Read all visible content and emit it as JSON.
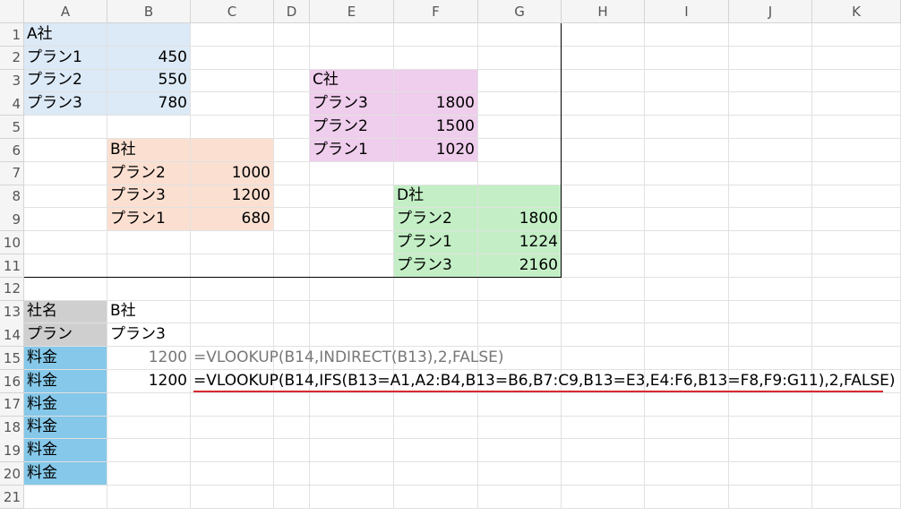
{
  "columns": [
    "A",
    "B",
    "C",
    "D",
    "E",
    "F",
    "G",
    "H",
    "I",
    "J",
    "K"
  ],
  "rows": [
    "1",
    "2",
    "3",
    "4",
    "5",
    "6",
    "7",
    "8",
    "9",
    "10",
    "11",
    "12",
    "13",
    "14",
    "15",
    "16",
    "17",
    "18",
    "19",
    "20",
    "21"
  ],
  "colors": {
    "a_block": "#dce9f6",
    "b_block": "#fbe0d2",
    "c_block": "#efcdec",
    "d_block": "#c4efc6",
    "label_gray": "#cfcfcf",
    "label_blue": "#85c8e9",
    "underline_red": "#d9282f"
  },
  "cells": [
    {
      "ref": "A1",
      "text": "A社",
      "fill": "a_block"
    },
    {
      "ref": "B1",
      "text": "",
      "fill": "a_block"
    },
    {
      "ref": "A2",
      "text": "プラン1",
      "fill": "a_block"
    },
    {
      "ref": "B2",
      "text": "450",
      "fill": "a_block",
      "align": "right"
    },
    {
      "ref": "A3",
      "text": "プラン2",
      "fill": "a_block"
    },
    {
      "ref": "B3",
      "text": "550",
      "fill": "a_block",
      "align": "right"
    },
    {
      "ref": "A4",
      "text": "プラン3",
      "fill": "a_block"
    },
    {
      "ref": "B4",
      "text": "780",
      "fill": "a_block",
      "align": "right"
    },
    {
      "ref": "E3",
      "text": "C社",
      "fill": "c_block"
    },
    {
      "ref": "F3",
      "text": "",
      "fill": "c_block"
    },
    {
      "ref": "E4",
      "text": "プラン3",
      "fill": "c_block"
    },
    {
      "ref": "F4",
      "text": "1800",
      "fill": "c_block",
      "align": "right"
    },
    {
      "ref": "E5",
      "text": "プラン2",
      "fill": "c_block"
    },
    {
      "ref": "F5",
      "text": "1500",
      "fill": "c_block",
      "align": "right"
    },
    {
      "ref": "E6",
      "text": "プラン1",
      "fill": "c_block"
    },
    {
      "ref": "F6",
      "text": "1020",
      "fill": "c_block",
      "align": "right"
    },
    {
      "ref": "B6",
      "text": "B社",
      "fill": "b_block"
    },
    {
      "ref": "C6",
      "text": "",
      "fill": "b_block"
    },
    {
      "ref": "B7",
      "text": "プラン2",
      "fill": "b_block"
    },
    {
      "ref": "C7",
      "text": "1000",
      "fill": "b_block",
      "align": "right"
    },
    {
      "ref": "B8",
      "text": "プラン3",
      "fill": "b_block"
    },
    {
      "ref": "C8",
      "text": "1200",
      "fill": "b_block",
      "align": "right"
    },
    {
      "ref": "B9",
      "text": "プラン1",
      "fill": "b_block"
    },
    {
      "ref": "C9",
      "text": "680",
      "fill": "b_block",
      "align": "right"
    },
    {
      "ref": "F8",
      "text": "D社",
      "fill": "d_block"
    },
    {
      "ref": "G8",
      "text": "",
      "fill": "d_block"
    },
    {
      "ref": "F9",
      "text": "プラン2",
      "fill": "d_block"
    },
    {
      "ref": "G9",
      "text": "1800",
      "fill": "d_block",
      "align": "right"
    },
    {
      "ref": "F10",
      "text": "プラン1",
      "fill": "d_block"
    },
    {
      "ref": "G10",
      "text": "1224",
      "fill": "d_block",
      "align": "right"
    },
    {
      "ref": "F11",
      "text": "プラン3",
      "fill": "d_block"
    },
    {
      "ref": "G11",
      "text": "2160",
      "fill": "d_block",
      "align": "right"
    },
    {
      "ref": "A13",
      "text": "社名",
      "fill": "label_gray"
    },
    {
      "ref": "B13",
      "text": "B社"
    },
    {
      "ref": "A14",
      "text": "プラン",
      "fill": "label_gray"
    },
    {
      "ref": "B14",
      "text": "プラン3"
    },
    {
      "ref": "A15",
      "text": "料金",
      "fill": "label_blue"
    },
    {
      "ref": "B15",
      "text": "1200",
      "align": "right",
      "style": "gray"
    },
    {
      "ref": "C15",
      "text": "=VLOOKUP(B14,INDIRECT(B13),2,FALSE)",
      "style": "gray"
    },
    {
      "ref": "A16",
      "text": "料金",
      "fill": "label_blue"
    },
    {
      "ref": "B16",
      "text": "1200",
      "align": "right"
    },
    {
      "ref": "C16",
      "text": "=VLOOKUP(B14,IFS(B13=A1,A2:B4,B13=B6,B7:C9,B13=E3,E4:F6,B13=F8,F9:G11),2,FALSE)"
    },
    {
      "ref": "A17",
      "text": "料金",
      "fill": "label_blue"
    },
    {
      "ref": "A18",
      "text": "料金",
      "fill": "label_blue"
    },
    {
      "ref": "A19",
      "text": "料金",
      "fill": "label_blue"
    },
    {
      "ref": "A20",
      "text": "料金",
      "fill": "label_blue"
    }
  ]
}
